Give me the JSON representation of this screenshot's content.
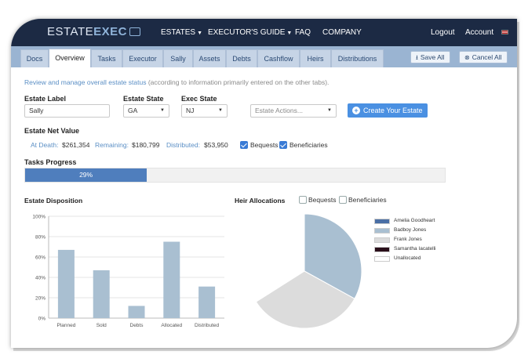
{
  "brand": {
    "name_a": "ESTATE",
    "name_b": "EXEC"
  },
  "topnav": {
    "estates": "ESTATES",
    "guide": "EXECUTOR'S GUIDE",
    "faq": "FAQ",
    "company": "COMPANY",
    "logout": "Logout",
    "account": "Account"
  },
  "tabs": [
    "Docs",
    "Overview",
    "Tasks",
    "Executor",
    "Sally",
    "Assets",
    "Debts",
    "Cashflow",
    "Heirs",
    "Distributions"
  ],
  "actions": {
    "save": "Save All",
    "cancel": "Cancel All"
  },
  "intro": {
    "main": "Review and manage overall estate status",
    "note": "(according to information primarily entered on the other tabs)."
  },
  "form": {
    "estate_label": {
      "label": "Estate Label",
      "value": "Sally"
    },
    "estate_state": {
      "label": "Estate State",
      "value": "GA"
    },
    "exec_state": {
      "label": "Exec State",
      "value": "NJ"
    },
    "estate_actions": {
      "placeholder": "Estate Actions..."
    },
    "create_button": "Create Your Estate"
  },
  "net_value": {
    "title": "Estate Net Value",
    "at_death_label": "At Death:",
    "at_death": "$261,354",
    "remaining_label": "Remaining:",
    "remaining": "$180,799",
    "distributed_label": "Distributed:",
    "distributed": "$53,950",
    "bequests": "Bequests",
    "beneficiaries": "Beneficiaries",
    "bequests_checked": true,
    "beneficiaries_checked": true
  },
  "tasks": {
    "title": "Tasks Progress",
    "percent_label": "29%",
    "percent": 29
  },
  "disposition": {
    "title": "Estate Disposition"
  },
  "heirs": {
    "title": "Heir Allocations",
    "bequests": "Bequests",
    "beneficiaries": "Beneficiaries",
    "bequests_checked": false,
    "beneficiaries_checked": false
  },
  "colors": {
    "nav": "#1c2a44",
    "tabbar": "#9ab4d2",
    "accent": "#4a90e2",
    "bar": "#a9bfd1"
  },
  "chart_data": [
    {
      "type": "bar",
      "categories": [
        "Planned",
        "Sold",
        "Debts",
        "Allocated",
        "Distributed"
      ],
      "values": [
        67,
        47,
        12,
        75,
        31
      ],
      "ylim": [
        0,
        100
      ],
      "yticks": [
        "0%",
        "20%",
        "40%",
        "60%",
        "80%",
        "100%"
      ],
      "grid": true
    },
    {
      "type": "pie",
      "labels": [
        "Amelia Goodheart",
        "Badboy Jones",
        "Frank Jones",
        "Samantha Iacatelli",
        "Unallocated"
      ],
      "colors": [
        "#4a6fa5",
        "#a9bfd1",
        "#dcdcdc",
        "#2a0f1a",
        "#ffffff"
      ],
      "values": [
        0,
        33,
        33,
        0,
        34
      ],
      "legend": "right"
    }
  ]
}
